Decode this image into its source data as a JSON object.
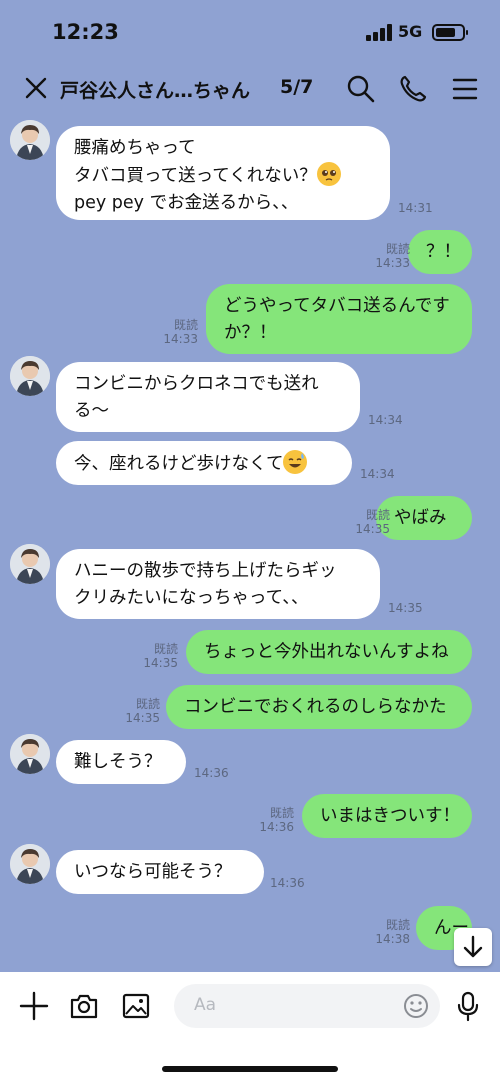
{
  "status_bar": {
    "time": "12:23",
    "network": "5G",
    "battery_level": 0.75
  },
  "header": {
    "title": "戸谷公人さん…ちゃん",
    "page_count": "5/7"
  },
  "messages": [
    {
      "side": "in",
      "lines": [
        "腰痛めちゃって",
        "タバコ買って送ってくれない？",
        "pey pey でお金送るから、、"
      ],
      "time": "14:31"
    },
    {
      "side": "out",
      "text": "？！",
      "read": "既読",
      "time": "14:33"
    },
    {
      "side": "out",
      "lines": [
        "どうやってタバコ送るんです",
        "か？！"
      ],
      "read": "既読",
      "time": "14:33"
    },
    {
      "side": "in",
      "lines": [
        "コンビニからクロネコでも送れ",
        "る〜"
      ],
      "time": "14:34"
    },
    {
      "side": "in",
      "text": "今、座れるけど歩けなくて",
      "time": "14:34"
    },
    {
      "side": "out",
      "text": "やばみ",
      "read": "既読",
      "time": "14:35"
    },
    {
      "side": "in",
      "lines": [
        "ハニーの散歩で持ち上げたらギッ",
        "クリみたいになっちゃって、、"
      ],
      "time": "14:35"
    },
    {
      "side": "out",
      "text": "ちょっと今外出れないんすよね",
      "read": "既読",
      "time": "14:35"
    },
    {
      "side": "out",
      "text": "コンビニでおくれるのしらなかた",
      "read": "既読",
      "time": "14:35"
    },
    {
      "side": "in",
      "text": "難しそう？",
      "time": "14:36"
    },
    {
      "side": "out",
      "text": "いまはきついす！",
      "read": "既読",
      "time": "14:36"
    },
    {
      "side": "in",
      "text": "いつなら可能そう？",
      "time": "14:36"
    },
    {
      "side": "out",
      "text": "んー",
      "read": "既読",
      "time": "14:38"
    }
  ],
  "composer": {
    "placeholder": "Aa"
  },
  "icons": {
    "close": "close-icon",
    "search": "search-icon",
    "call": "phone-icon",
    "menu": "menu-icon",
    "scroll": "arrow-down-icon",
    "add": "plus-icon",
    "camera": "camera-icon",
    "image": "image-icon",
    "emoji": "emoji-icon",
    "mic": "microphone-icon"
  },
  "colors": {
    "background": "#8fa2d2",
    "incoming_bubble": "#ffffff",
    "outgoing_bubble": "#85e57a",
    "meta_text": "#5c6780"
  }
}
